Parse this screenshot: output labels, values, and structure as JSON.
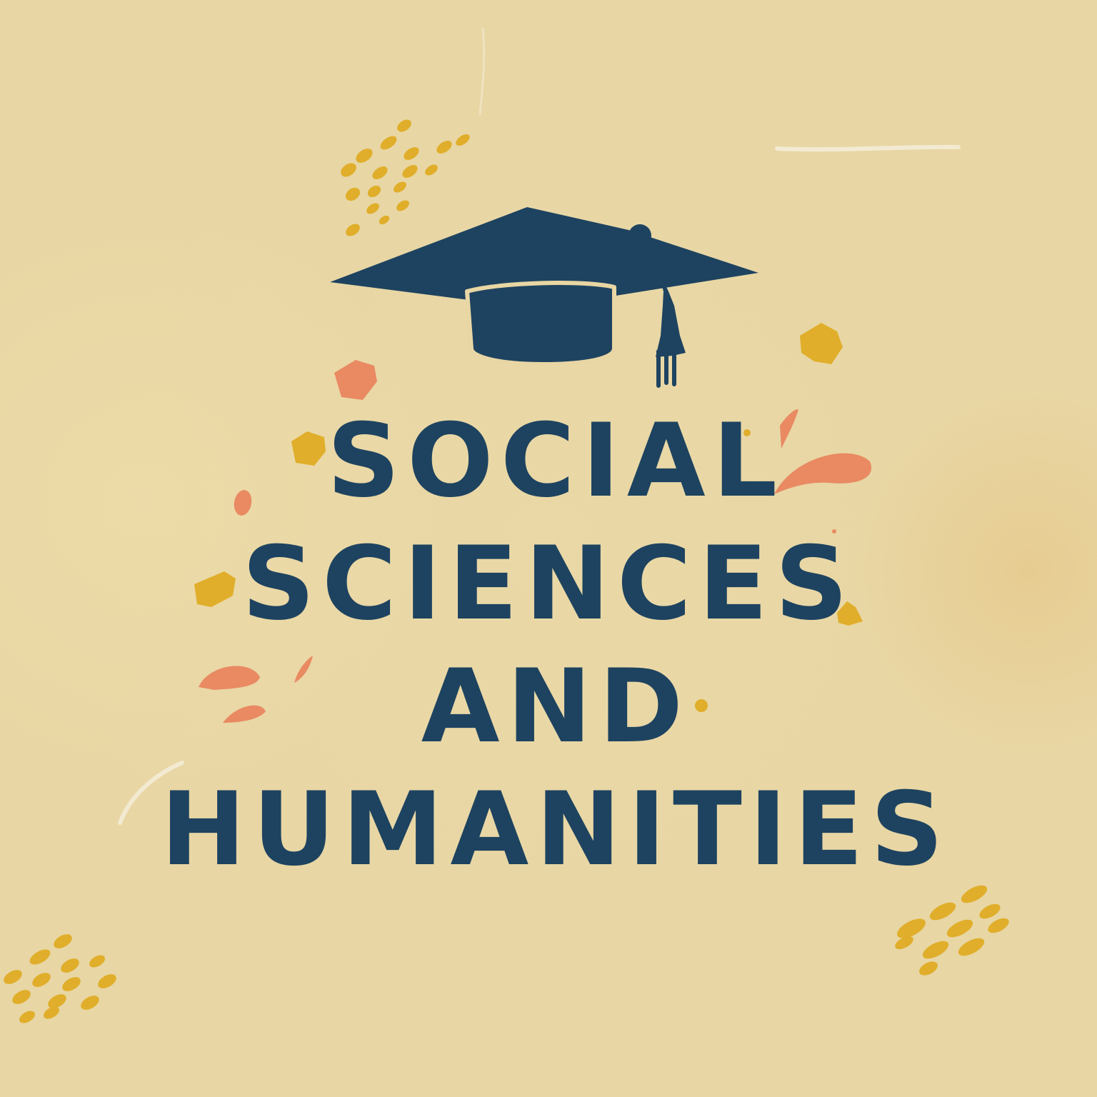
{
  "title": {
    "line1": "SOCIAL",
    "line2": "SCIENCES",
    "line3": "AND",
    "line4": "HUMANITIES"
  },
  "icons": {
    "cap": "graduation-cap-icon"
  },
  "colors": {
    "background": "#E8D6A4",
    "ink": "#1E4360",
    "mustard": "#E0AE2A",
    "coral": "#E98A62",
    "chalk": "#F5EEDB"
  }
}
